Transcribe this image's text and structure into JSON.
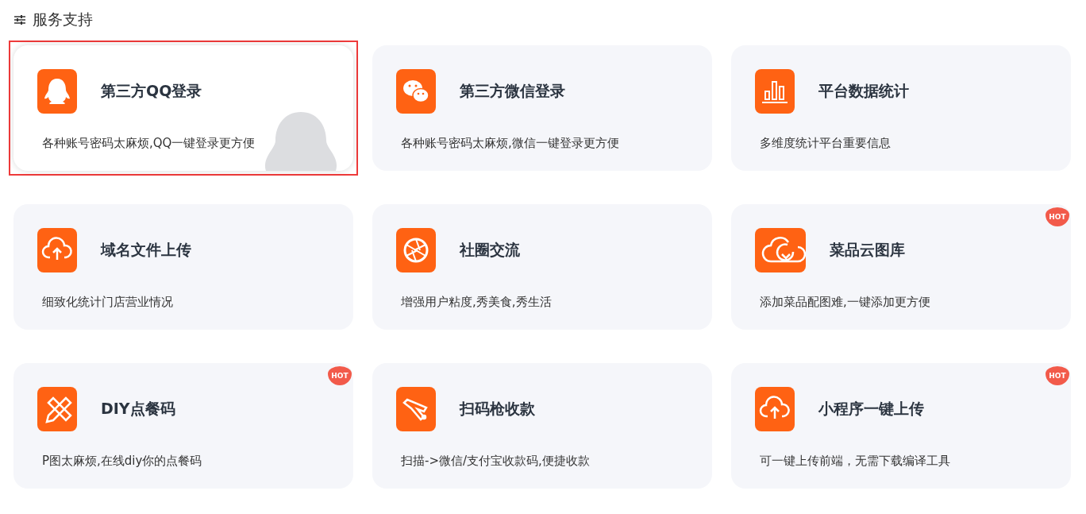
{
  "section": {
    "title": "服务支持"
  },
  "cards": [
    {
      "kind": "qq",
      "title": "第三方QQ登录",
      "description": "各种账号密码太麻烦,QQ一键登录更方便",
      "selected": true
    },
    {
      "kind": "wechat",
      "title": "第三方微信登录",
      "description": "各种账号密码太麻烦,微信一键登录更方便",
      "selected": false
    },
    {
      "kind": "stats",
      "title": "平台数据统计",
      "description": "多维度统计平台重要信息",
      "selected": false
    },
    {
      "kind": "upload",
      "title": "域名文件上传",
      "description": "细致化统计门店营业情况",
      "selected": false
    },
    {
      "kind": "aperture",
      "title": "社圈交流",
      "description": "增强用户粘度,秀美食,秀生活",
      "selected": false
    },
    {
      "kind": "cloud",
      "title": "菜品云图库",
      "description": "添加菜品配图难,一键添加更方便",
      "badge": "HOT",
      "selected": false
    },
    {
      "kind": "tools",
      "title": "DIY点餐码",
      "description": "P图太麻烦,在线diy你的点餐码",
      "badge": "HOT",
      "selected": false
    },
    {
      "kind": "scanner",
      "title": "扫码枪收款",
      "description": "扫描->微信/支付宝收款码,便捷收款",
      "selected": false
    },
    {
      "kind": "upload",
      "title": "小程序一键上传",
      "description": "可一键上传前端，无需下载编译工具",
      "badge": "HOT",
      "selected": false
    }
  ]
}
